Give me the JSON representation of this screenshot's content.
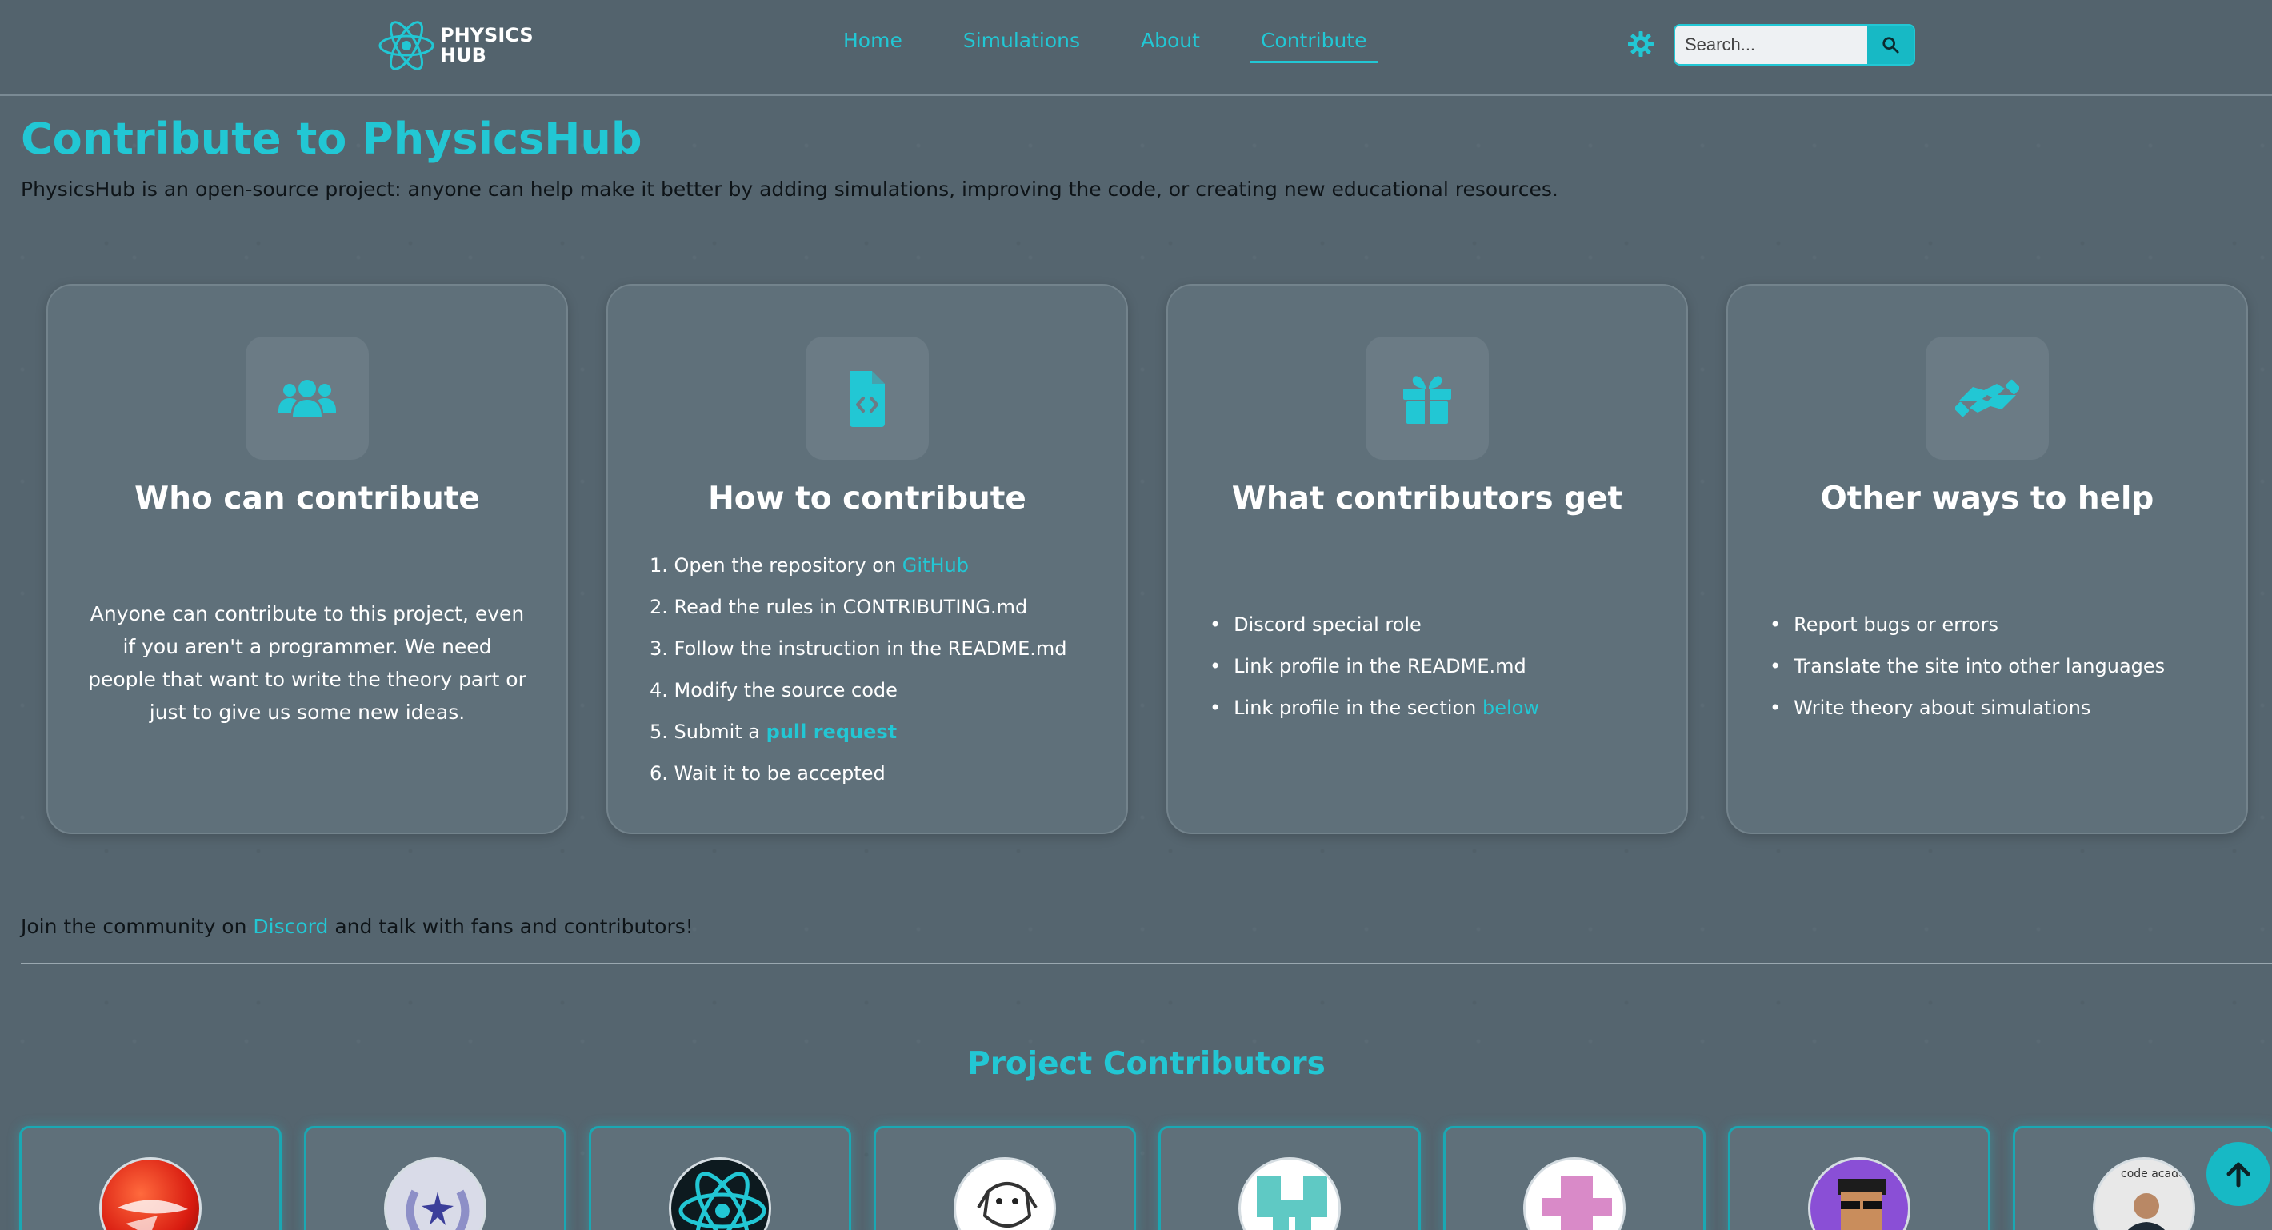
{
  "header": {
    "logo_line1": "PHYSICS",
    "logo_line2": "HUB",
    "nav": [
      {
        "label": "Home"
      },
      {
        "label": "Simulations"
      },
      {
        "label": "About"
      },
      {
        "label": "Contribute",
        "active": true
      }
    ],
    "search_placeholder": "Search..."
  },
  "colors": {
    "accent": "#22c7d4",
    "background": "#55656f",
    "card": "#5f707a"
  },
  "intro": {
    "title": "Contribute to PhysicsHub",
    "text": "PhysicsHub is an open-source project: anyone can help make it better by adding simulations, improving the code, or creating new educational resources."
  },
  "cards": {
    "who": {
      "icon": "users-icon",
      "title": "Who can contribute",
      "text": "Anyone can contribute to this project, even if you aren't a programmer. We need people that want to write the theory part or just to give us some new ideas."
    },
    "how": {
      "icon": "file-code-icon",
      "title": "How to contribute",
      "steps": [
        {
          "prefix": "1. Open the repository on ",
          "link": "GitHub"
        },
        {
          "text": "2. Read the rules in CONTRIBUTING.md"
        },
        {
          "text": "3. Follow the instruction in the README.md"
        },
        {
          "text": "4. Modify the source code"
        },
        {
          "prefix": "5. Submit a ",
          "link": "pull request"
        },
        {
          "text": "6. Wait it to be accepted"
        }
      ]
    },
    "get": {
      "icon": "gift-icon",
      "title": "What contributors get",
      "items": [
        {
          "text": "Discord special role"
        },
        {
          "text": "Link profile in the README.md"
        },
        {
          "prefix": "Link profile in the section ",
          "link": "below"
        }
      ]
    },
    "other": {
      "icon": "handshake-icon",
      "title": "Other ways to help",
      "items": [
        "Report bugs or errors",
        "Translate the site into other languages",
        "Write theory about simulations"
      ]
    }
  },
  "community": {
    "prefix": "Join the community on ",
    "link": "Discord",
    "suffix": " and talk with fans and contributors!"
  },
  "contributors": {
    "title": "Project Contributors",
    "avatars": [
      "red-sphere-avatar",
      "laurel-star-avatar",
      "atom-avatar",
      "dog-sketch-avatar",
      "teal-pixel-avatar",
      "pink-pixel-avatar",
      "sunglasses-avatar",
      "code-academy-avatar"
    ],
    "partial_text": "code academy"
  }
}
